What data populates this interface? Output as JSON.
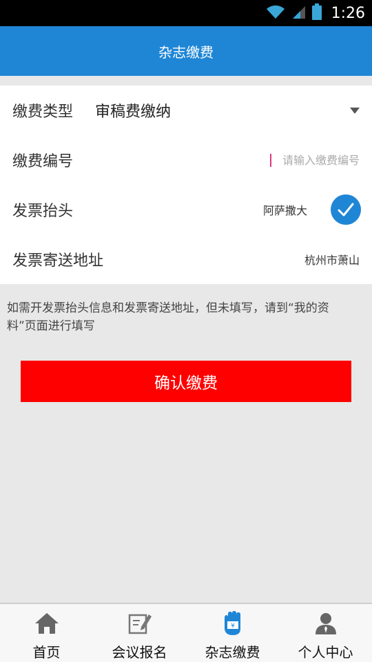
{
  "status_bar": {
    "time": "1:26"
  },
  "app_bar": {
    "title": "杂志缴费"
  },
  "form": {
    "fee_type": {
      "label": "缴费类型",
      "value": "审稿费缴纳"
    },
    "fee_code": {
      "label": "缴费编号",
      "placeholder": "请输入缴费编号",
      "value": ""
    },
    "invoice_title": {
      "label": "发票抬头",
      "value": "阿萨撒大",
      "checked": true
    },
    "invoice_address": {
      "label": "发票寄送地址",
      "value": "杭州市萧山"
    }
  },
  "note": "如需开发票抬头信息和发票寄送地址，但未填写，请到“我的资料”页面进行填写",
  "confirm_button": "确认缴费",
  "tabs": [
    {
      "label": "首页",
      "icon": "home-icon"
    },
    {
      "label": "会议报名",
      "icon": "edit-form-icon"
    },
    {
      "label": "杂志缴费",
      "icon": "payment-hand-icon",
      "active": true
    },
    {
      "label": "个人中心",
      "icon": "user-icon"
    }
  ],
  "colors": {
    "primary": "#1f86d6",
    "confirm": "#ff0000",
    "background": "#e8e8e8"
  }
}
